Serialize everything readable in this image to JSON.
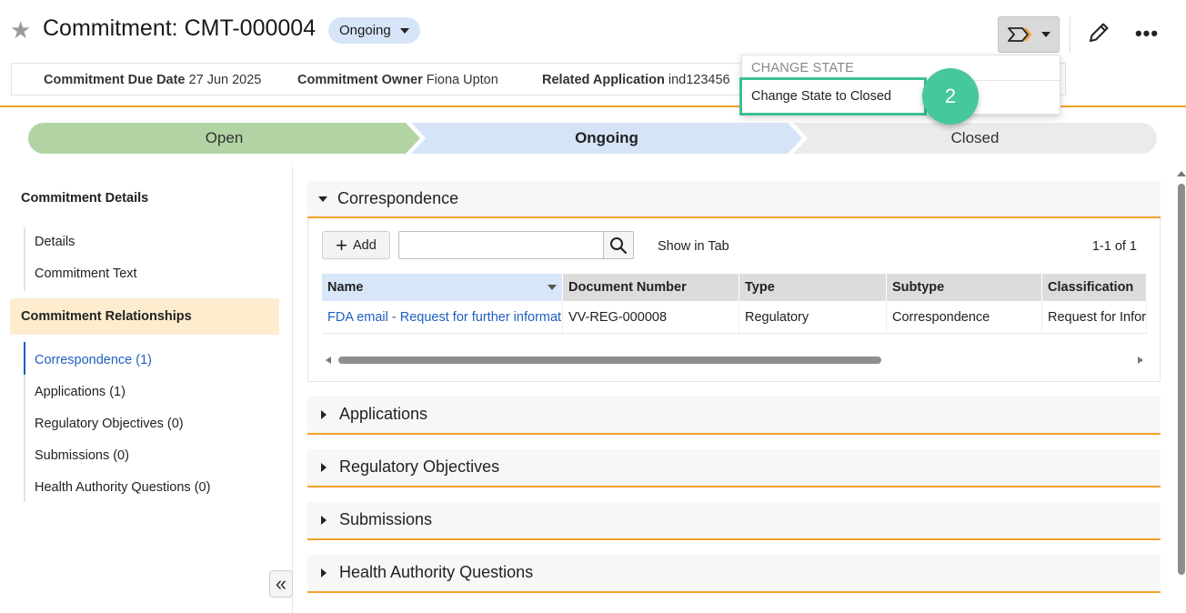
{
  "header": {
    "title": "Commitment: CMT-000004",
    "state": "Ongoing"
  },
  "key_fields": [
    {
      "label": "Commitment Due Date",
      "value": "27 Jun 2025"
    },
    {
      "label": "Commitment Owner",
      "value": "Fiona Upton"
    },
    {
      "label": "Related Application",
      "value": "ind123456"
    }
  ],
  "lifecycle": {
    "stages": [
      "Open",
      "Ongoing",
      "Closed"
    ],
    "colors": {
      "open": "#b2d4a4",
      "ongoing": "#d6e4f8",
      "closed": "#ebebeb"
    }
  },
  "change_state_menu": {
    "header": "CHANGE STATE",
    "item": "Change State to Closed",
    "step_number": "2"
  },
  "left_nav": {
    "section1": "Commitment Details",
    "section1_items": [
      "Details",
      "Commitment Text"
    ],
    "section2": "Commitment Relationships",
    "section2_items": [
      "Correspondence (1)",
      "Applications (1)",
      "Regulatory Objectives (0)",
      "Submissions (0)",
      "Health Authority Questions (0)"
    ]
  },
  "correspondence": {
    "title": "Correspondence",
    "add_label": "Add",
    "show_in_tab": "Show in Tab",
    "pager": "1-1 of 1",
    "columns": [
      "Name",
      "Document Number",
      "Type",
      "Subtype",
      "Classification"
    ],
    "rows": [
      [
        "FDA email - Request for further information",
        "VV-REG-000008",
        "Regulatory",
        "Correspondence",
        "Request for Information"
      ]
    ]
  },
  "sections": [
    "Applications",
    "Regulatory Objectives",
    "Submissions",
    "Health Authority Questions"
  ],
  "colors": {
    "accent_orange": "#f3a12a",
    "link_blue": "#1f5fbf",
    "highlight_green": "#3dbf94"
  }
}
